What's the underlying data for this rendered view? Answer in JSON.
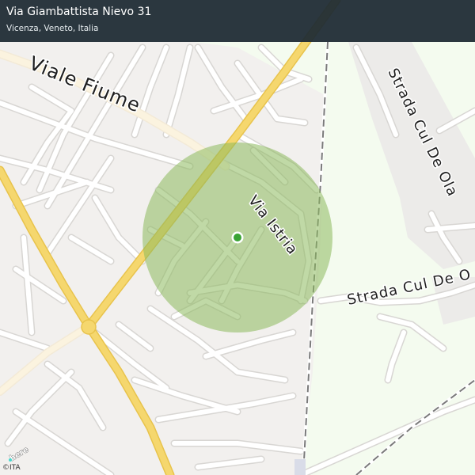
{
  "header": {
    "title": "Via Giambattista Nievo 31",
    "subtitle": "Vicenza, Veneto, Italia"
  },
  "map": {
    "labels": {
      "viale_fiume": "Viale Fiume",
      "via_istria": "Via Istria",
      "strada_cul_de_ola": "Strada Cul De Ola",
      "strada_cul_de_2": "Strada Cul De O"
    },
    "colors": {
      "background_urban": "#f2f0ee",
      "background_green": "#f4fbef",
      "major_road": "#f5d76e",
      "minor_road": "#ffffff",
      "railway": "#7a7a7a",
      "accuracy_circle": "#8dba5c",
      "location_dot": "#3aa335",
      "header_bg": "#1e2b34"
    }
  },
  "footer": {
    "logo_text": "here",
    "copyright": "©ITA"
  }
}
